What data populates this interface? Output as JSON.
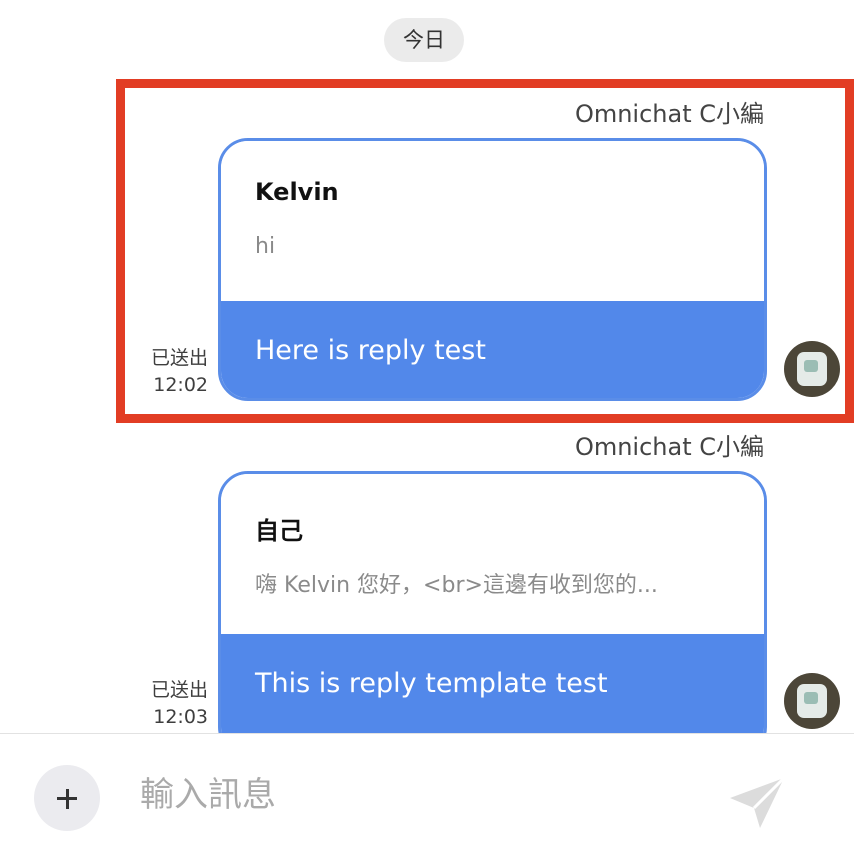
{
  "date_divider": "今日",
  "messages": [
    {
      "sender": "Omnichat C小編",
      "reply_to": {
        "name": "Kelvin",
        "text": "hi"
      },
      "body": "Here is reply test",
      "status": "已送出",
      "time": "12:02",
      "highlighted": true
    },
    {
      "sender": "Omnichat C小編",
      "reply_to": {
        "name": "自己",
        "text": "嗨 Kelvin 您好，<br>這邊有收到您的..."
      },
      "body": "This is reply template test",
      "status": "已送出",
      "time": "12:03",
      "highlighted": false
    }
  ],
  "composer": {
    "placeholder": "輸入訊息",
    "add_icon": "plus-icon",
    "send_icon": "send-paper-plane-icon"
  },
  "colors": {
    "bubble_border": "#5a8de8",
    "bubble_fill": "#5288ea",
    "highlight": "#e23d24",
    "date_pill": "#ebebeb"
  }
}
